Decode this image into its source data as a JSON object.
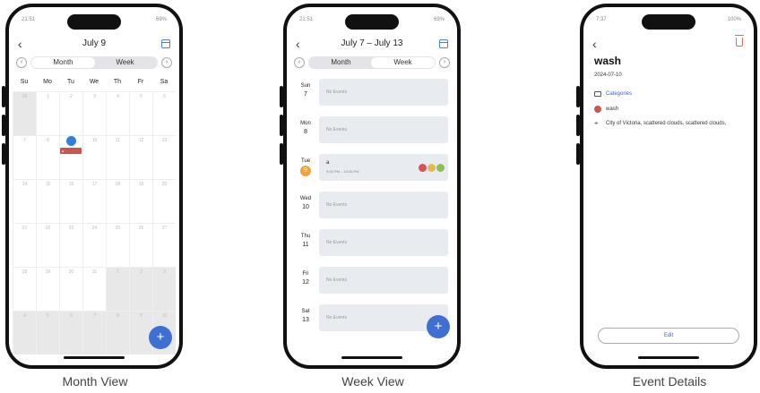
{
  "captions": [
    "Month View",
    "Week View",
    "Event Details"
  ],
  "month": {
    "status_time": "21:51",
    "status_right": "69%",
    "title": "July 9",
    "seg_month": "Month",
    "seg_week": "Week",
    "dow": [
      "Su",
      "Mo",
      "Tu",
      "We",
      "Th",
      "Fr",
      "Sa"
    ],
    "weeks": [
      [
        "30",
        "1",
        "2",
        "3",
        "4",
        "5",
        "6"
      ],
      [
        "7",
        "8",
        "9",
        "10",
        "11",
        "12",
        "13"
      ],
      [
        "14",
        "15",
        "16",
        "17",
        "18",
        "19",
        "20"
      ],
      [
        "21",
        "22",
        "23",
        "24",
        "25",
        "26",
        "27"
      ],
      [
        "28",
        "29",
        "30",
        "31",
        "1",
        "2",
        "3"
      ],
      [
        "4",
        "5",
        "6",
        "7",
        "8",
        "9",
        "10"
      ]
    ],
    "today": "9",
    "event_bar": "a",
    "fab": "+"
  },
  "week": {
    "status_time": "21:51",
    "status_right": "69%",
    "title": "July 7 – July 13",
    "seg_month": "Month",
    "seg_week": "Week",
    "days": [
      {
        "dow": "Sun",
        "num": "7",
        "text": "No Events"
      },
      {
        "dow": "Mon",
        "num": "8",
        "text": "No Events"
      },
      {
        "dow": "Tue",
        "num": "9",
        "title": "a",
        "time": "9:00 PM – 10:00 PM"
      },
      {
        "dow": "Wed",
        "num": "10",
        "text": "No Events"
      },
      {
        "dow": "Thu",
        "num": "11",
        "text": "No Events"
      },
      {
        "dow": "Fri",
        "num": "12",
        "text": "No Events"
      },
      {
        "dow": "Sat",
        "num": "13",
        "text": "No Events"
      }
    ],
    "dot_colors": [
      "#d9534f",
      "#e8b84a",
      "#8cc152"
    ],
    "fab": "+"
  },
  "details": {
    "status_time": "7:37",
    "status_right": "100%",
    "title": "wash",
    "date": "2024-07-10",
    "categories": "Categories",
    "tag": "wash",
    "weather": "City of Victoria, scattered clouds, scattered clouds,",
    "edit": "Edit"
  },
  "colors": {
    "accent": "#3f6fd0",
    "event": "#c9574f",
    "today_badge": "#f2a23a"
  }
}
